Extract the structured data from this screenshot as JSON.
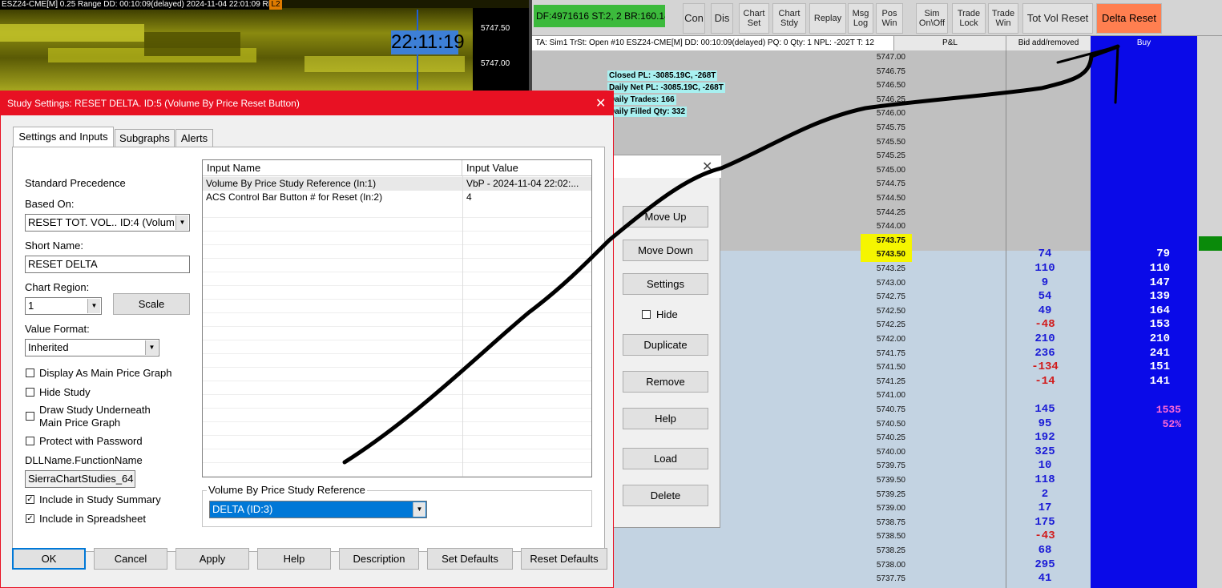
{
  "chart_left": {
    "header": "ESZ24-CME[M]  0.25 Range DD: 00:10:09(delayed) 2024-11-04 22:01:09 RR:0.25",
    "badge": "L2",
    "time": "22:11:19",
    "prices": [
      "5747.50",
      "5747.00"
    ]
  },
  "toolbar": {
    "status": "DF:4971616  ST:2, 2  BR:160.14",
    "buttons": [
      {
        "id": "con",
        "label": "Con"
      },
      {
        "id": "dis",
        "label": "Dis"
      },
      {
        "id": "chart-set",
        "label": "Chart\nSet"
      },
      {
        "id": "chart-stdy",
        "label": "Chart\nStdy"
      },
      {
        "id": "replay",
        "label": "Replay"
      },
      {
        "id": "msg-log",
        "label": "Msg\nLog"
      },
      {
        "id": "pos-win",
        "label": "Pos\nWin"
      },
      {
        "id": "sim",
        "label": "Sim\nOn\\Off"
      },
      {
        "id": "trade-lock",
        "label": "Trade\nLock"
      },
      {
        "id": "trade-win",
        "label": "Trade\nWin"
      },
      {
        "id": "tot-vol-reset",
        "label": "Tot Vol Reset"
      },
      {
        "id": "delta-reset",
        "label": "Delta Reset"
      }
    ]
  },
  "dom": {
    "info": "TA: Sim1  TrSt: Open  #10 ESZ24-CME[M]  DD: 00:10:09(delayed)  PQ: 0  Qty: 1  NPL: -202T  T: 12",
    "col_pl": "P&L",
    "col_bid": "Bid add/removed",
    "col_buy": "Buy",
    "stats": [
      "Closed PL: -3085.19C, -268T",
      "Daily Net PL: -3085.19C, -268T",
      "Daily Trades: 166",
      "Daily Filled Qty: 332"
    ],
    "rows": [
      {
        "price": "5747.00",
        "bid": "",
        "buy": ""
      },
      {
        "price": "5746.75",
        "bid": "",
        "buy": ""
      },
      {
        "price": "5746.50",
        "bid": "",
        "buy": ""
      },
      {
        "price": "5746.25",
        "bid": "",
        "buy": ""
      },
      {
        "price": "5746.00",
        "bid": "",
        "buy": ""
      },
      {
        "price": "5745.75",
        "bid": "",
        "buy": ""
      },
      {
        "price": "5745.50",
        "bid": "",
        "buy": ""
      },
      {
        "price": "5745.25",
        "bid": "",
        "buy": ""
      },
      {
        "price": "5745.00",
        "bid": "",
        "buy": ""
      },
      {
        "price": "5744.75",
        "bid": "",
        "buy": ""
      },
      {
        "price": "5744.50",
        "bid": "",
        "buy": ""
      },
      {
        "price": "5744.25",
        "bid": "",
        "buy": ""
      },
      {
        "price": "5744.00",
        "bid": "",
        "buy": ""
      },
      {
        "price": "5743.75",
        "bid": "",
        "buy": ""
      },
      {
        "price": "5743.50",
        "bid": "74",
        "buy": "79"
      },
      {
        "price": "5743.25",
        "bid": "110",
        "buy": "110"
      },
      {
        "price": "5743.00",
        "bid": "9",
        "buy": "147"
      },
      {
        "price": "5742.75",
        "bid": "54",
        "buy": "139"
      },
      {
        "price": "5742.50",
        "bid": "49",
        "buy": "164"
      },
      {
        "price": "5742.25",
        "bid": "-48",
        "buy": "153"
      },
      {
        "price": "5742.00",
        "bid": "210",
        "buy": "210"
      },
      {
        "price": "5741.75",
        "bid": "236",
        "buy": "241"
      },
      {
        "price": "5741.50",
        "bid": "-134",
        "buy": "151"
      },
      {
        "price": "5741.25",
        "bid": "-14",
        "buy": "141"
      },
      {
        "price": "5741.00",
        "bid": "",
        "buy": ""
      },
      {
        "price": "5740.75",
        "bid": "145",
        "buy": "1535"
      },
      {
        "price": "5740.50",
        "bid": "95",
        "buy": "52%"
      },
      {
        "price": "5740.25",
        "bid": "192",
        "buy": ""
      },
      {
        "price": "5740.00",
        "bid": "325",
        "buy": ""
      },
      {
        "price": "5739.75",
        "bid": "10",
        "buy": ""
      },
      {
        "price": "5739.50",
        "bid": "118",
        "buy": ""
      },
      {
        "price": "5739.25",
        "bid": "2",
        "buy": ""
      },
      {
        "price": "5739.00",
        "bid": "17",
        "buy": ""
      },
      {
        "price": "5738.75",
        "bid": "175",
        "buy": ""
      },
      {
        "price": "5738.50",
        "bid": "-43",
        "buy": ""
      },
      {
        "price": "5738.25",
        "bid": "68",
        "buy": ""
      },
      {
        "price": "5738.00",
        "bid": "295",
        "buy": ""
      },
      {
        "price": "5737.75",
        "bid": "41",
        "buy": ""
      }
    ]
  },
  "study_list": {
    "buttons": [
      "Move Up",
      "Move Down",
      "Settings",
      "Duplicate",
      "Remove",
      "Help",
      "Load",
      "Delete"
    ],
    "hide_label": "Hide"
  },
  "dialog": {
    "title": "Study Settings: RESET DELTA. ID:5 (Volume By Price Reset Button)",
    "tabs": [
      "Settings and Inputs",
      "Subgraphs",
      "Alerts"
    ],
    "standard_precedence": "Standard Precedence",
    "based_on_label": "Based On:",
    "based_on_value": "RESET TOT. VOL.. ID:4 (Volum",
    "short_name_label": "Short Name:",
    "short_name_value": "RESET DELTA",
    "chart_region_label": "Chart Region:",
    "chart_region_value": "1",
    "scale_label": "Scale",
    "value_format_label": "Value Format:",
    "value_format_value": "Inherited",
    "checks": [
      {
        "label": "Display As Main Price Graph",
        "checked": false
      },
      {
        "label": "Hide Study",
        "checked": false
      },
      {
        "label": "Draw Study Underneath\nMain Price Graph",
        "checked": false
      },
      {
        "label": "Protect with Password",
        "checked": false
      }
    ],
    "dll_label": "DLLName.FunctionName",
    "dll_value": "SierraChartStudies_64",
    "checks2": [
      {
        "label": "Include in Study Summary",
        "checked": true
      },
      {
        "label": "Include in Spreadsheet",
        "checked": true
      }
    ],
    "inputs_table": {
      "headers": [
        "Input Name",
        "Input Value"
      ],
      "rows": [
        {
          "name": "Volume By Price Study Reference  (In:1)",
          "value": "VbP - 2024-11-04  22:02:..."
        },
        {
          "name": "ACS Control Bar Button # for Reset  (In:2)",
          "value": "4"
        }
      ]
    },
    "group_label": "Volume By Price Study Reference",
    "group_value": "DELTA (ID:3)",
    "bottom_buttons": [
      "OK",
      "Cancel",
      "Apply",
      "Help",
      "Description",
      "Set Defaults",
      "Reset Defaults"
    ]
  },
  "colors": {
    "dialog_title_bg": "#e81123",
    "delta_reset_bg": "#ff7f50",
    "buy_column": "#0a0ae8",
    "bid_text": "#1a1ad6",
    "bid_negative": "#d11a1a"
  }
}
